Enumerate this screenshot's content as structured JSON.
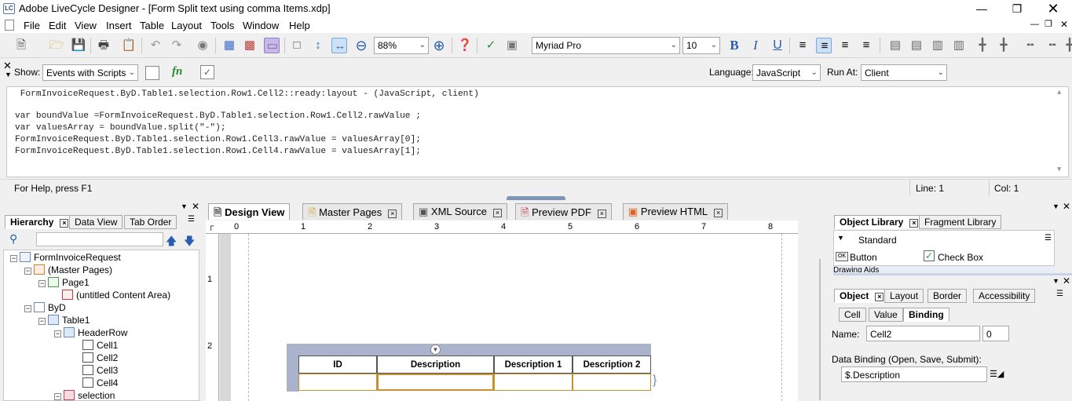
{
  "window": {
    "title": "Adobe LiveCycle Designer - [Form Split text using comma Items.xdp]",
    "app_icon": "LC"
  },
  "menu": [
    "File",
    "Edit",
    "View",
    "Insert",
    "Table",
    "Layout",
    "Tools",
    "Window",
    "Help"
  ],
  "toolbar": {
    "zoom": "88%",
    "font": "Myriad Pro",
    "font_size": "10"
  },
  "script_bar": {
    "show_label": "Show:",
    "show_value": "Events with Scripts",
    "fn_label": "fn",
    "language_label": "Language:",
    "language_value": "JavaScript",
    "runat_label": "Run At:",
    "runat_value": "Client"
  },
  "editor": {
    "lines": [
      " FormInvoiceRequest.ByD.Table1.selection.Row1.Cell2::ready:layout - (JavaScript, client)",
      "",
      "var boundValue =FormInvoiceRequest.ByD.Table1.selection.Row1.Cell2.rawValue ;",
      "var valuesArray = boundValue.split(\"-\");",
      "FormInvoiceRequest.ByD.Table1.selection.Row1.Cell3.rawValue = valuesArray[0];",
      "FormInvoiceRequest.ByD.Table1.selection.Row1.Cell4.rawValue = valuesArray[1];"
    ]
  },
  "status": {
    "help": "For Help, press F1",
    "line": "Line: 1",
    "col": "Col: 1"
  },
  "hierarchy": {
    "tabs": [
      "Hierarchy",
      "Data View",
      "Tab Order"
    ],
    "tree": [
      {
        "label": "FormInvoiceRequest",
        "indent": 0,
        "icon": "form-icon",
        "expander": "-"
      },
      {
        "label": "(Master Pages)",
        "indent": 1,
        "icon": "master-pages-icon",
        "expander": "-"
      },
      {
        "label": "Page1",
        "indent": 2,
        "icon": "page-icon",
        "expander": "-"
      },
      {
        "label": "(untitled Content Area)",
        "indent": 3,
        "icon": "content-area-icon",
        "expander": ""
      },
      {
        "label": "ByD",
        "indent": 1,
        "icon": "subform-icon",
        "expander": "-"
      },
      {
        "label": "Table1",
        "indent": 2,
        "icon": "table-icon",
        "expander": "-"
      },
      {
        "label": "HeaderRow",
        "indent": 3,
        "icon": "row-icon",
        "expander": "-"
      },
      {
        "label": "Cell1",
        "indent": 4,
        "icon": "text-icon",
        "expander": ""
      },
      {
        "label": "Cell2",
        "indent": 4,
        "icon": "text-icon",
        "expander": ""
      },
      {
        "label": "Cell3",
        "indent": 4,
        "icon": "text-icon",
        "expander": ""
      },
      {
        "label": "Cell4",
        "indent": 4,
        "icon": "text-icon",
        "expander": ""
      },
      {
        "label": "selection",
        "indent": 3,
        "icon": "row-icon",
        "expander": "-"
      }
    ]
  },
  "doc_tabs": [
    "Design View",
    "Master Pages",
    "XML Source",
    "Preview PDF",
    "Preview HTML"
  ],
  "ruler": {
    "h": [
      "0",
      "1",
      "2",
      "3",
      "4",
      "5",
      "6",
      "7",
      "8"
    ],
    "v": [
      "1",
      "2"
    ]
  },
  "table": {
    "headers": [
      "ID",
      "Description",
      "Description 1",
      "Description 2"
    ]
  },
  "object_library": {
    "tabs": [
      "Object Library",
      "Fragment Library"
    ],
    "group": "Standard",
    "items": [
      "Button",
      "Check Box"
    ],
    "next_group": "Drawing Aids"
  },
  "object_panel": {
    "tabs": [
      "Object",
      "Layout",
      "Border",
      "Accessibility"
    ],
    "subtabs": [
      "Cell",
      "Value",
      "Binding"
    ],
    "name_label": "Name:",
    "name_value": "Cell2",
    "index_value": "0",
    "binding_label": "Data Binding (Open, Save, Submit):",
    "binding_value": "$.Description"
  }
}
